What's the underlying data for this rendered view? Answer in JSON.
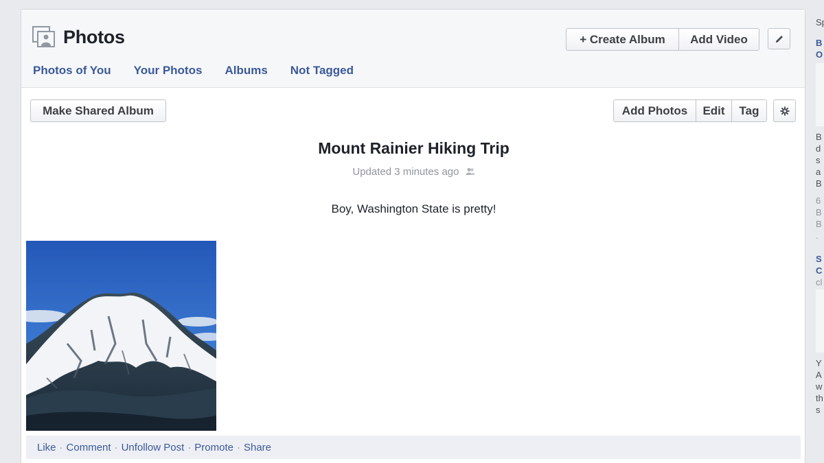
{
  "header": {
    "title": "Photos",
    "tabs": [
      "Photos of You",
      "Your Photos",
      "Albums",
      "Not Tagged"
    ],
    "create_album_label": "+ Create Album",
    "add_video_label": "Add Video"
  },
  "toolbar": {
    "make_shared_label": "Make Shared Album",
    "add_photos_label": "Add Photos",
    "edit_label": "Edit",
    "tag_label": "Tag"
  },
  "album": {
    "title": "Mount Rainier Hiking Trip",
    "updated": "Updated 3 minutes ago",
    "description": "Boy, Washington State is pretty!"
  },
  "actions": [
    "Like",
    "Comment",
    "Unfollow Post",
    "Promote",
    "Share"
  ],
  "sidebar_fragments": [
    "Sp",
    "B",
    "O",
    "B",
    "d",
    "s",
    "a",
    "B",
    "6",
    "B",
    "B",
    ".",
    "S",
    "C",
    "cl",
    "Y",
    "A",
    "w",
    "th",
    "s"
  ],
  "colors": {
    "link": "#3b5998",
    "background": "#e9eaed"
  },
  "icons": [
    "photos-icon",
    "pencil-icon",
    "gear-icon",
    "shared-people-icon"
  ]
}
